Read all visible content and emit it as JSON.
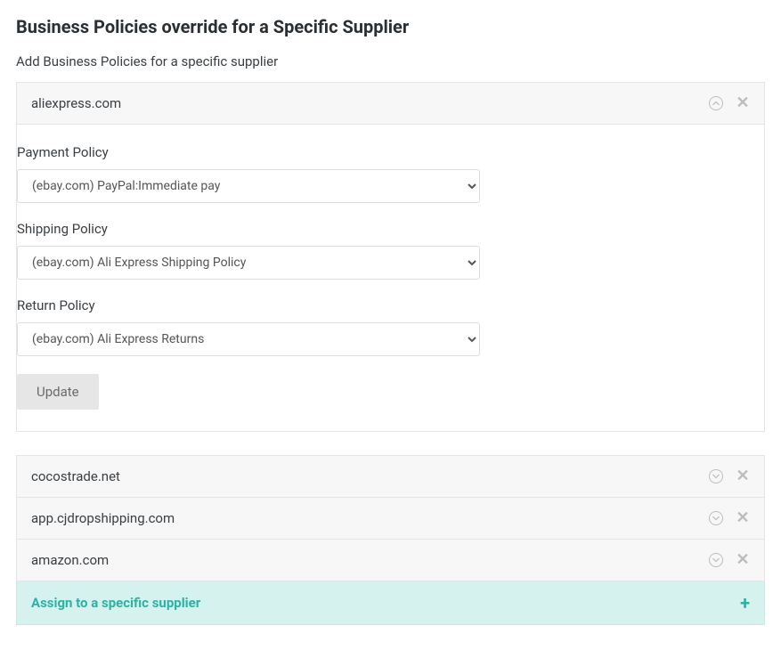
{
  "header": {
    "title": "Business Policies override for a Specific Supplier",
    "subtitle": "Add Business Policies for a specific supplier"
  },
  "suppliers": [
    {
      "name": "aliexpress.com",
      "expanded": true
    },
    {
      "name": "cocostrade.net",
      "expanded": false
    },
    {
      "name": "app.cjdropshipping.com",
      "expanded": false
    },
    {
      "name": "amazon.com",
      "expanded": false
    }
  ],
  "form": {
    "payment": {
      "label": "Payment Policy",
      "value": "(ebay.com) PayPal:Immediate pay"
    },
    "shipping": {
      "label": "Shipping Policy",
      "value": "(ebay.com) Ali Express Shipping Policy"
    },
    "return": {
      "label": "Return Policy",
      "value": "(ebay.com) Ali Express Returns"
    },
    "update_button": "Update"
  },
  "assign": {
    "label": "Assign to a specific supplier"
  }
}
